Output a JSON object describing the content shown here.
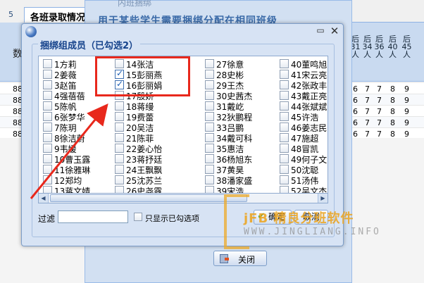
{
  "background": {
    "tab_number": "5",
    "tab_title": "各班录取情况",
    "left_label": "数",
    "behind_window_title": "内班捆绑",
    "behind_window_banner": "用于某些学生需要捆绑分配在相同班级",
    "column_headers": [
      "后31人",
      "后34人",
      "后36人",
      "后40人",
      "后45人"
    ],
    "row_lead": [
      "88",
      "88",
      "88",
      "88",
      "88"
    ],
    "rows": [
      [
        "6",
        "7",
        "7",
        "8",
        "9"
      ],
      [
        "6",
        "7",
        "7",
        "8",
        "9"
      ],
      [
        "6",
        "7",
        "7",
        "8",
        "9"
      ],
      [
        "6",
        "7",
        "7",
        "8",
        "9"
      ],
      [
        "6",
        "7",
        "7",
        "8",
        "9"
      ]
    ]
  },
  "dialog": {
    "group_title": "捆绑组成员（已勾选2）",
    "columns": [
      [
        {
          "label": "1方莉",
          "checked": false
        },
        {
          "label": "2姜薇",
          "checked": false
        },
        {
          "label": "3赵笛",
          "checked": false
        },
        {
          "label": "4强蓓蓓",
          "checked": false
        },
        {
          "label": "5陈帆",
          "checked": false
        },
        {
          "label": "6张梦华",
          "checked": false
        },
        {
          "label": "7陈玥",
          "checked": false
        },
        {
          "label": "8徐洁蔚",
          "checked": false
        },
        {
          "label": "9韦媛",
          "checked": false
        },
        {
          "label": "10曹玉露",
          "checked": false
        },
        {
          "label": "11徐雅琳",
          "checked": false
        },
        {
          "label": "12郑均",
          "checked": false
        },
        {
          "label": "13蒋文婧",
          "checked": false
        }
      ],
      [
        {
          "label": "14张洁",
          "checked": false
        },
        {
          "label": "15彭丽燕",
          "checked": true
        },
        {
          "label": "16彭丽娟",
          "checked": true
        },
        {
          "label": "17殷娇",
          "checked": false
        },
        {
          "label": "18蒋缦",
          "checked": false
        },
        {
          "label": "19费蕾",
          "checked": false
        },
        {
          "label": "20吴洁",
          "checked": false
        },
        {
          "label": "21陈菲",
          "checked": false
        },
        {
          "label": "22姜心怡",
          "checked": false
        },
        {
          "label": "23蒋抒廷",
          "checked": false
        },
        {
          "label": "24王飘飘",
          "checked": false
        },
        {
          "label": "25沈苏兰",
          "checked": false
        },
        {
          "label": "26史尧露",
          "checked": false
        }
      ],
      [
        {
          "label": "27徐意",
          "checked": false
        },
        {
          "label": "28史彬",
          "checked": false
        },
        {
          "label": "29王杰",
          "checked": false
        },
        {
          "label": "30史茜杰",
          "checked": false
        },
        {
          "label": "31戴屹",
          "checked": false
        },
        {
          "label": "32狄鹏程",
          "checked": false
        },
        {
          "label": "33吕鹏",
          "checked": false
        },
        {
          "label": "34戴可科",
          "checked": false
        },
        {
          "label": "35惠洁",
          "checked": false
        },
        {
          "label": "36杨旭东",
          "checked": false
        },
        {
          "label": "37黄昊",
          "checked": false
        },
        {
          "label": "38潘家盛",
          "checked": false
        },
        {
          "label": "39宋浩",
          "checked": false
        }
      ],
      [
        {
          "label": "40董鸣旭",
          "checked": false
        },
        {
          "label": "41宋云亮",
          "checked": false
        },
        {
          "label": "42张政丰",
          "checked": false
        },
        {
          "label": "43戴正亮",
          "checked": false
        },
        {
          "label": "44张斌斌",
          "checked": false
        },
        {
          "label": "45许浩",
          "checked": false
        },
        {
          "label": "46姜志民",
          "checked": false
        },
        {
          "label": "47施超",
          "checked": false
        },
        {
          "label": "48冒凯",
          "checked": false
        },
        {
          "label": "49何子文",
          "checked": false
        },
        {
          "label": "50沈聪",
          "checked": false
        },
        {
          "label": "51汤伟",
          "checked": false
        },
        {
          "label": "52吴文杰",
          "checked": false
        }
      ]
    ],
    "filter_label": "过滤",
    "filter_value": "",
    "only_checked_label": "只显示已勾选项",
    "ok_label": "确定",
    "cancel_label": "取消"
  },
  "close_button_label": "关闭",
  "watermark": {
    "title": "jFB 精良分班软件",
    "url": "WWW.JINGLIANG.INFO"
  },
  "colors": {
    "highlight": "#e8281c",
    "accent": "#15428b",
    "watermark": "#eca420"
  },
  "icons": [
    "app-icon",
    "maximize-icon",
    "close-icon",
    "checkmark-icon",
    "exit-door-icon",
    "arrow-annotation"
  ]
}
